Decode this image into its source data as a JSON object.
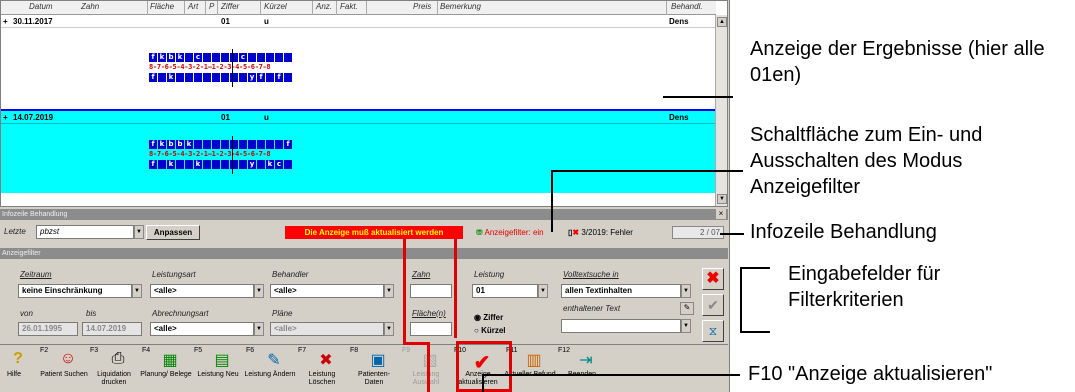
{
  "grid": {
    "columns": [
      "Datum",
      "Zahn",
      "Fläche",
      "Art",
      "P",
      "Ziffer",
      "Kürzel",
      "Anz.",
      "Fakt.",
      "Preis",
      "Bemerkung",
      "Behandl."
    ],
    "rows": [
      {
        "date": "30.11.2017",
        "ziffer": "01",
        "kuerzel": "u",
        "behandler": "Dens",
        "upper": [
          "f",
          "k",
          "b",
          "k",
          "",
          "c",
          "",
          "",
          "",
          "",
          "c",
          "",
          "",
          "",
          "",
          ""
        ],
        "lower": [
          "f",
          "",
          "k",
          "",
          "",
          "",
          "",
          "",
          "",
          "",
          "",
          "y",
          "f",
          "",
          "f",
          ""
        ]
      },
      {
        "date": "14.07.2019",
        "ziffer": "01",
        "kuerzel": "u",
        "behandler": "Dens",
        "upper": [
          "f",
          "k",
          "b",
          "b",
          "k",
          "",
          "",
          "",
          "",
          "",
          "",
          "",
          "",
          "",
          "",
          "f"
        ],
        "lower": [
          "f",
          "",
          "k",
          "",
          "",
          "k",
          "",
          "",
          "",
          "",
          "",
          "y",
          "",
          "k",
          "c",
          ""
        ]
      }
    ],
    "tooth_numbers": "8-7-6-5-4-3-2-1—1-2-3-4-5-6-7-8",
    "highlight_color": "#00ffff"
  },
  "infobar": {
    "title": "Infozeile Behandlung",
    "letzte_label": "Letzte",
    "letzte_value": "pbzst",
    "anpassen": "Anpassen",
    "warning": "Die Anzeige muß aktualisiert werden",
    "filter_status": "Anzeigefilter: ein",
    "status": "3/2019: Fehler",
    "counter": "2 / 07"
  },
  "filter": {
    "title": "Anzeigefilter",
    "zeitraum_label": "Zeitraum",
    "zeitraum_value": "keine Einschränkung",
    "von_label": "von",
    "bis_label": "bis",
    "von_value": "26.01.1995",
    "bis_value": "14.07.2019",
    "leistungsart_label": "Leistungsart",
    "leistungsart_value": "<alle>",
    "abrechnungsart_label": "Abrechnungsart",
    "abrechnungsart_value": "<alle>",
    "behandler_label": "Behandler",
    "behandler_value": "<alle>",
    "plaene_label": "Pläne",
    "plaene_value": "<alle>",
    "zahn_label": "Zahn",
    "flaeche_label": "Fläche(n)",
    "leistung_label": "Leistung",
    "leistung_value": "01",
    "ziffer_radio": "Ziffer",
    "kuerzel_radio": "Kürzel",
    "volltext_label": "Volltextsuche in",
    "volltext_value": "allen Textinhalten",
    "enthaltener_label": "enthaltener Text"
  },
  "fkeys": [
    {
      "key": "",
      "label": "Hilfe"
    },
    {
      "key": "F2",
      "label": "Patient Suchen"
    },
    {
      "key": "F3",
      "label": "Liquidation drucken"
    },
    {
      "key": "F4",
      "label": "Planung/ Belege"
    },
    {
      "key": "F5",
      "label": "Leistung Neu"
    },
    {
      "key": "F6",
      "label": "Leistung Ändern"
    },
    {
      "key": "F7",
      "label": "Leistung Löschen"
    },
    {
      "key": "F8",
      "label": "Patienten- Daten"
    },
    {
      "key": "F9",
      "label": "Leistung Auswahl"
    },
    {
      "key": "F10",
      "label": "Anzeige aktualisieren"
    },
    {
      "key": "F11",
      "label": "Aktueller Befund"
    },
    {
      "key": "F12",
      "label": "Beenden"
    }
  ],
  "callouts": {
    "results": "Anzeige der Ergebnisse (hier alle 01en)",
    "toggle": "Schaltfläche zum Ein- und Ausschalten des Modus Anzeigefilter",
    "infozeile": "Infozeile Behandlung",
    "eingabe": "Eingabefelder für Filterkriterien",
    "f10": "F10 \"Anzeige aktualisieren\""
  }
}
